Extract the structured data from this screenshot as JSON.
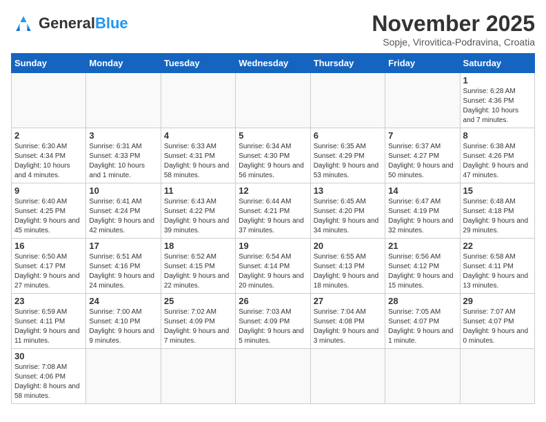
{
  "header": {
    "logo_general": "General",
    "logo_blue": "Blue",
    "month_title": "November 2025",
    "subtitle": "Sopje, Virovitica-Podravina, Croatia"
  },
  "weekdays": [
    "Sunday",
    "Monday",
    "Tuesday",
    "Wednesday",
    "Thursday",
    "Friday",
    "Saturday"
  ],
  "weeks": [
    [
      {
        "day": "",
        "info": ""
      },
      {
        "day": "",
        "info": ""
      },
      {
        "day": "",
        "info": ""
      },
      {
        "day": "",
        "info": ""
      },
      {
        "day": "",
        "info": ""
      },
      {
        "day": "",
        "info": ""
      },
      {
        "day": "1",
        "info": "Sunrise: 6:28 AM\nSunset: 4:36 PM\nDaylight: 10 hours and 7 minutes."
      }
    ],
    [
      {
        "day": "2",
        "info": "Sunrise: 6:30 AM\nSunset: 4:34 PM\nDaylight: 10 hours and 4 minutes."
      },
      {
        "day": "3",
        "info": "Sunrise: 6:31 AM\nSunset: 4:33 PM\nDaylight: 10 hours and 1 minute."
      },
      {
        "day": "4",
        "info": "Sunrise: 6:33 AM\nSunset: 4:31 PM\nDaylight: 9 hours and 58 minutes."
      },
      {
        "day": "5",
        "info": "Sunrise: 6:34 AM\nSunset: 4:30 PM\nDaylight: 9 hours and 56 minutes."
      },
      {
        "day": "6",
        "info": "Sunrise: 6:35 AM\nSunset: 4:29 PM\nDaylight: 9 hours and 53 minutes."
      },
      {
        "day": "7",
        "info": "Sunrise: 6:37 AM\nSunset: 4:27 PM\nDaylight: 9 hours and 50 minutes."
      },
      {
        "day": "8",
        "info": "Sunrise: 6:38 AM\nSunset: 4:26 PM\nDaylight: 9 hours and 47 minutes."
      }
    ],
    [
      {
        "day": "9",
        "info": "Sunrise: 6:40 AM\nSunset: 4:25 PM\nDaylight: 9 hours and 45 minutes."
      },
      {
        "day": "10",
        "info": "Sunrise: 6:41 AM\nSunset: 4:24 PM\nDaylight: 9 hours and 42 minutes."
      },
      {
        "day": "11",
        "info": "Sunrise: 6:43 AM\nSunset: 4:22 PM\nDaylight: 9 hours and 39 minutes."
      },
      {
        "day": "12",
        "info": "Sunrise: 6:44 AM\nSunset: 4:21 PM\nDaylight: 9 hours and 37 minutes."
      },
      {
        "day": "13",
        "info": "Sunrise: 6:45 AM\nSunset: 4:20 PM\nDaylight: 9 hours and 34 minutes."
      },
      {
        "day": "14",
        "info": "Sunrise: 6:47 AM\nSunset: 4:19 PM\nDaylight: 9 hours and 32 minutes."
      },
      {
        "day": "15",
        "info": "Sunrise: 6:48 AM\nSunset: 4:18 PM\nDaylight: 9 hours and 29 minutes."
      }
    ],
    [
      {
        "day": "16",
        "info": "Sunrise: 6:50 AM\nSunset: 4:17 PM\nDaylight: 9 hours and 27 minutes."
      },
      {
        "day": "17",
        "info": "Sunrise: 6:51 AM\nSunset: 4:16 PM\nDaylight: 9 hours and 24 minutes."
      },
      {
        "day": "18",
        "info": "Sunrise: 6:52 AM\nSunset: 4:15 PM\nDaylight: 9 hours and 22 minutes."
      },
      {
        "day": "19",
        "info": "Sunrise: 6:54 AM\nSunset: 4:14 PM\nDaylight: 9 hours and 20 minutes."
      },
      {
        "day": "20",
        "info": "Sunrise: 6:55 AM\nSunset: 4:13 PM\nDaylight: 9 hours and 18 minutes."
      },
      {
        "day": "21",
        "info": "Sunrise: 6:56 AM\nSunset: 4:12 PM\nDaylight: 9 hours and 15 minutes."
      },
      {
        "day": "22",
        "info": "Sunrise: 6:58 AM\nSunset: 4:11 PM\nDaylight: 9 hours and 13 minutes."
      }
    ],
    [
      {
        "day": "23",
        "info": "Sunrise: 6:59 AM\nSunset: 4:11 PM\nDaylight: 9 hours and 11 minutes."
      },
      {
        "day": "24",
        "info": "Sunrise: 7:00 AM\nSunset: 4:10 PM\nDaylight: 9 hours and 9 minutes."
      },
      {
        "day": "25",
        "info": "Sunrise: 7:02 AM\nSunset: 4:09 PM\nDaylight: 9 hours and 7 minutes."
      },
      {
        "day": "26",
        "info": "Sunrise: 7:03 AM\nSunset: 4:09 PM\nDaylight: 9 hours and 5 minutes."
      },
      {
        "day": "27",
        "info": "Sunrise: 7:04 AM\nSunset: 4:08 PM\nDaylight: 9 hours and 3 minutes."
      },
      {
        "day": "28",
        "info": "Sunrise: 7:05 AM\nSunset: 4:07 PM\nDaylight: 9 hours and 1 minute."
      },
      {
        "day": "29",
        "info": "Sunrise: 7:07 AM\nSunset: 4:07 PM\nDaylight: 9 hours and 0 minutes."
      }
    ],
    [
      {
        "day": "30",
        "info": "Sunrise: 7:08 AM\nSunset: 4:06 PM\nDaylight: 8 hours and 58 minutes."
      },
      {
        "day": "",
        "info": ""
      },
      {
        "day": "",
        "info": ""
      },
      {
        "day": "",
        "info": ""
      },
      {
        "day": "",
        "info": ""
      },
      {
        "day": "",
        "info": ""
      },
      {
        "day": "",
        "info": ""
      }
    ]
  ]
}
